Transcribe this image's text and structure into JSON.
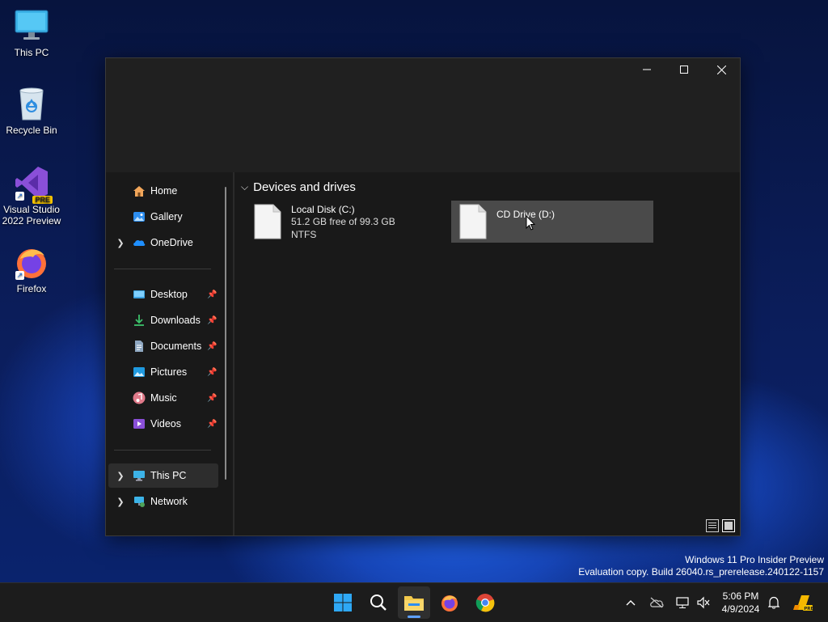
{
  "desktop": {
    "icons": [
      {
        "label": "This PC",
        "icon": "monitor-icon"
      },
      {
        "label": "Recycle Bin",
        "icon": "recycle-bin-icon"
      },
      {
        "label": "Visual Studio 2022 Preview",
        "badge": "PRE",
        "icon": "visual-studio-icon"
      },
      {
        "label": "Firefox",
        "icon": "firefox-icon"
      }
    ]
  },
  "window": {
    "caption_buttons": [
      "minimize",
      "maximize",
      "close"
    ],
    "nav": {
      "items": [
        {
          "label": "Home",
          "icon": "home-icon",
          "expandable": false
        },
        {
          "label": "Gallery",
          "icon": "gallery-icon",
          "expandable": false
        },
        {
          "label": "OneDrive",
          "icon": "onedrive-cloud-icon",
          "expandable": true
        }
      ],
      "quick_access": [
        {
          "label": "Desktop",
          "icon": "desktop-folder-icon",
          "pinned": true
        },
        {
          "label": "Downloads",
          "icon": "download-icon",
          "pinned": true
        },
        {
          "label": "Documents",
          "icon": "documents-icon",
          "pinned": true
        },
        {
          "label": "Pictures",
          "icon": "pictures-icon",
          "pinned": true
        },
        {
          "label": "Music",
          "icon": "music-icon",
          "pinned": true
        },
        {
          "label": "Videos",
          "icon": "videos-icon",
          "pinned": true
        }
      ],
      "locations": [
        {
          "label": "This PC",
          "icon": "this-pc-icon",
          "expandable": true,
          "selected": true
        },
        {
          "label": "Network",
          "icon": "network-icon",
          "expandable": true
        }
      ]
    },
    "content": {
      "group_header": "Devices and drives",
      "drives": [
        {
          "name": "Local Disk (C:)",
          "free": "51.2 GB free of 99.3 GB",
          "fs": "NTFS"
        },
        {
          "name": "CD Drive (D:)",
          "hovered": true
        }
      ]
    },
    "view_buttons": [
      "details-view",
      "large-icons-view"
    ]
  },
  "watermark": {
    "line1": "Windows 11 Pro Insider Preview",
    "line2": "Evaluation copy. Build 26040.rs_prerelease.240122-1157"
  },
  "taskbar": {
    "apps": [
      "start-icon",
      "search-icon",
      "file-explorer-icon",
      "firefox-icon",
      "chrome-icon"
    ],
    "active_app": "file-explorer-icon",
    "tray": [
      "chevron-up-icon",
      "onedrive-offline-icon",
      "network-icon",
      "volume-muted-icon"
    ],
    "time": "5:06 PM",
    "date": "4/9/2024",
    "colors": {
      "accent": "#5ea0ff",
      "folder": "#f2c94c"
    }
  }
}
